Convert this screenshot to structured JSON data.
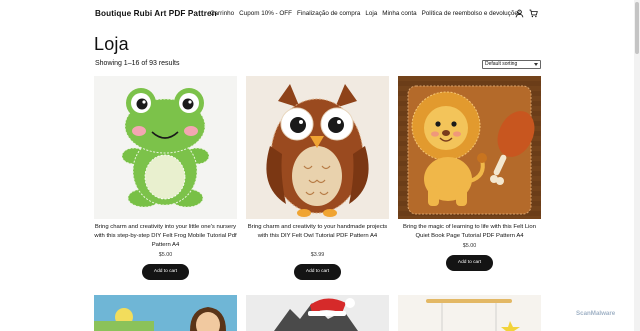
{
  "header": {
    "brand": "Boutique Rubi Art PDF Pattren",
    "nav": [
      "Carrinho",
      "Cupom 10% - OFF",
      "Finalização de compra",
      "Loja",
      "Minha conta",
      "Política de reembolso e devoluções"
    ],
    "icons": [
      "account-icon",
      "cart-icon"
    ]
  },
  "page": {
    "title": "Loja",
    "result_count": "Showing 1–16 of 93 results",
    "sort_selected": "Default sorting"
  },
  "products": [
    {
      "title": "Bring charm and creativity into your little one's nursery with this step-by-step DIY Felt Frog Mobile Tutorial Pdf Pattern A4",
      "price": "$5.00",
      "button": "Add to cart"
    },
    {
      "title": "Bring charm and creativity to your handmade projects with this DIY Felt Owl Tutorial PDF Pattern A4",
      "price": "$3.99",
      "button": "Add to cart"
    },
    {
      "title": "Bring the magic of learning to life with this Felt Lion Quiet Book Page Tutorial PDF Pattern A4",
      "price": "$5.00",
      "button": "Add to cart"
    }
  ],
  "watermark": "ScanMalware",
  "colors": {
    "button_bg": "#141414",
    "frog_green": "#7cc24a",
    "owl_brown": "#9a4a1f",
    "lion_gold": "#e6a336"
  }
}
